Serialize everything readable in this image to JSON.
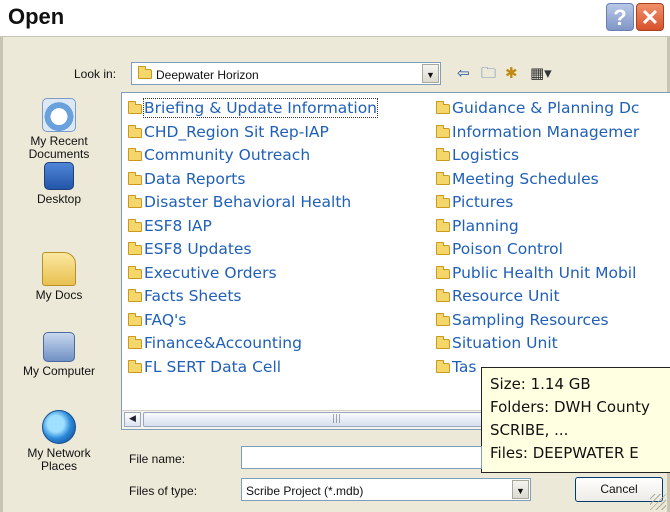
{
  "window": {
    "title": "Open",
    "help_glyph": "?",
    "close_glyph": "✕"
  },
  "toolbar": {
    "look_in_label": "Look in:",
    "look_in_value": "Deepwater Horizon",
    "back_icon": "back-arrow-icon",
    "up_icon": "up-folder-icon",
    "new_folder_icon": "new-folder-icon",
    "views_icon": "views-menu-icon"
  },
  "places": [
    {
      "label": "My Recent Documents",
      "icon": "recent-documents-icon"
    },
    {
      "label": "Desktop",
      "icon": "desktop-icon"
    },
    {
      "label": "My Docs",
      "icon": "my-documents-icon"
    },
    {
      "label": "My Computer",
      "icon": "my-computer-icon"
    },
    {
      "label": "My Network Places",
      "icon": "network-places-icon"
    }
  ],
  "files": {
    "column1": [
      "Briefing & Update Information",
      "CHD_Region Sit Rep-IAP",
      "Community Outreach",
      "Data Reports",
      "Disaster Behavioral Health",
      "ESF8 IAP",
      "ESF8 Updates",
      "Executive Orders",
      "Facts Sheets",
      "FAQ's",
      "Finance&Accounting",
      "FL SERT Data Cell"
    ],
    "column2": [
      "Guidance & Planning Dc",
      "Information Managemer",
      "Logistics",
      "Meeting Schedules",
      "Pictures",
      "Planning",
      "Poison Control",
      "Public Health Unit Mobil",
      "Resource Unit",
      "Sampling Resources",
      "Situation Unit",
      "Tas"
    ],
    "selected": "Briefing & Update Information"
  },
  "tooltip": {
    "line1": "Size: 1.14 GB",
    "line2": "Folders: DWH County",
    "line3": "SCRIBE, ...",
    "line4": "Files: DEEPWATER E"
  },
  "form": {
    "file_name_label": "File name:",
    "file_name_value": "",
    "file_type_label": "Files of type:",
    "file_type_value": "Scribe Project (*.mdb)",
    "cancel_label": "Cancel"
  },
  "colors": {
    "dialog_bg": "#ece9d8",
    "file_link": "#2060b8",
    "tooltip_bg": "#ffffe1",
    "folder": "#f4d66a"
  }
}
